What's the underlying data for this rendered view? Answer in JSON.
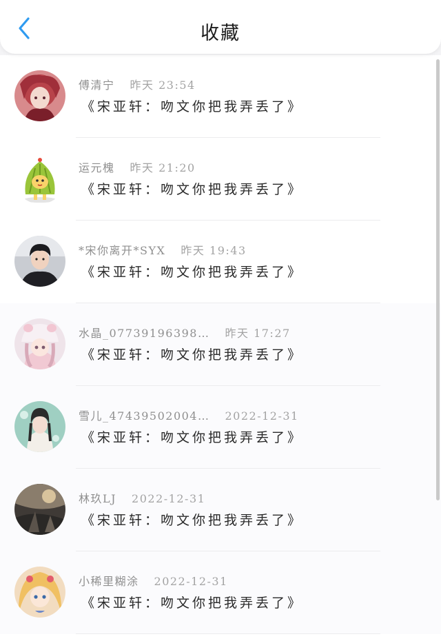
{
  "header": {
    "title": "收藏",
    "back_icon": "chevron-left-icon",
    "accent_color": "#2f9bf0"
  },
  "items": [
    {
      "name": "傅清宁",
      "time": "昨天 23:54",
      "message": "《宋亚轩：吻文你把我弄丢了》",
      "avatar": "anime-girl-red-hair"
    },
    {
      "name": "运元槐",
      "time": "昨天 21:20",
      "message": "《宋亚轩：吻文你把我弄丢了》",
      "avatar": "cartoon-green-character"
    },
    {
      "name": "*宋你离开*SYX",
      "time": "昨天 19:43",
      "message": "《宋亚轩：吻文你把我弄丢了》",
      "avatar": "boy-photo"
    },
    {
      "name": "水晶_07739196398…",
      "time": "昨天 17:27",
      "message": "《宋亚轩：吻文你把我弄丢了》",
      "avatar": "anime-girl-pink-hat"
    },
    {
      "name": "雪儿_47439502004…",
      "time": "2022-12-31",
      "message": "《宋亚轩：吻文你把我弄丢了》",
      "avatar": "girl-teal-background"
    },
    {
      "name": "林玖LJ",
      "time": "2022-12-31",
      "message": "《宋亚轩：吻文你把我弄丢了》",
      "avatar": "anime-scenery-dark"
    },
    {
      "name": "小稀里糊涂",
      "time": "2022-12-31",
      "message": "《宋亚轩：吻文你把我弄丢了》",
      "avatar": "anime-girl-blonde"
    }
  ]
}
